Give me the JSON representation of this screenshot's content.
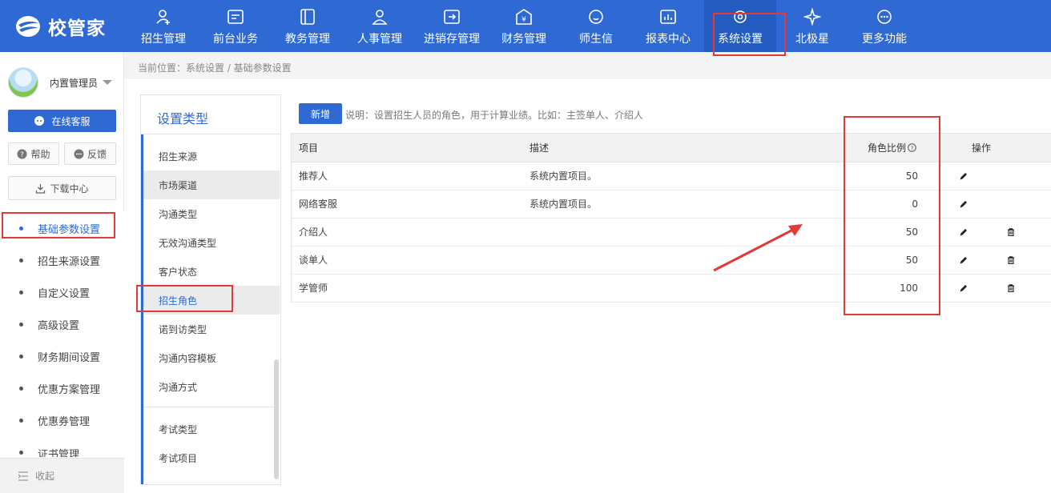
{
  "app": {
    "logo_text": "校管家"
  },
  "topnav": {
    "items": [
      {
        "label": "招生管理",
        "icon": "recruit-icon"
      },
      {
        "label": "前台业务",
        "icon": "frontdesk-icon"
      },
      {
        "label": "教务管理",
        "icon": "academic-icon"
      },
      {
        "label": "人事管理",
        "icon": "person-icon"
      },
      {
        "label": "进销存管理",
        "icon": "inventory-icon"
      },
      {
        "label": "财务管理",
        "icon": "finance-icon"
      },
      {
        "label": "师生信",
        "icon": "message-icon"
      },
      {
        "label": "报表中心",
        "icon": "report-icon"
      },
      {
        "label": "系统设置",
        "icon": "settings-icon"
      },
      {
        "label": "北极星",
        "icon": "star-icon"
      },
      {
        "label": "更多功能",
        "icon": "more-icon"
      }
    ],
    "active": "系统设置"
  },
  "sidebar": {
    "user_name": "内置管理员",
    "online_service": "在线客服",
    "help": "帮助",
    "feedback": "反馈",
    "download": "下载中心",
    "menu": [
      {
        "label": "基础参数设置",
        "active": true
      },
      {
        "label": "招生来源设置"
      },
      {
        "label": "自定义设置"
      },
      {
        "label": "高级设置"
      },
      {
        "label": "财务期间设置"
      },
      {
        "label": "优惠方案管理"
      },
      {
        "label": "优惠券管理"
      },
      {
        "label": "证书管理"
      }
    ],
    "collapse": "收起"
  },
  "breadcrumb": {
    "text": "当前位置：系统设置 / 基础参数设置"
  },
  "type_panel": {
    "title": "设置类型",
    "items": [
      {
        "label": "招生来源"
      },
      {
        "label": "市场渠道"
      },
      {
        "label": "沟通类型"
      },
      {
        "label": "无效沟通类型"
      },
      {
        "label": "客户状态"
      },
      {
        "label": "招生角色",
        "active": true
      },
      {
        "label": "诺到访类型"
      },
      {
        "label": "沟通内容模板"
      },
      {
        "label": "沟通方式"
      },
      {
        "label": "考试类型"
      },
      {
        "label": "考试项目"
      }
    ]
  },
  "main": {
    "new_button": "新增",
    "note": "说明：设置招生人员的角色，用于计算业绩。比如：主签单人、介绍人",
    "table": {
      "headers": {
        "item": "项目",
        "desc": "描述",
        "ratio": "角色比例",
        "ops": "操作"
      },
      "rows": [
        {
          "item": "推荐人",
          "desc": "系统内置项目。",
          "ratio": "50",
          "deletable": false
        },
        {
          "item": "网络客服",
          "desc": "系统内置项目。",
          "ratio": "0",
          "deletable": false
        },
        {
          "item": "介绍人",
          "desc": "",
          "ratio": "50",
          "deletable": true
        },
        {
          "item": "谈单人",
          "desc": "",
          "ratio": "50",
          "deletable": true
        },
        {
          "item": "学管师",
          "desc": "",
          "ratio": "100",
          "deletable": true
        }
      ]
    }
  },
  "colors": {
    "brand": "#2f6ad4",
    "annotation": "#e53935"
  }
}
